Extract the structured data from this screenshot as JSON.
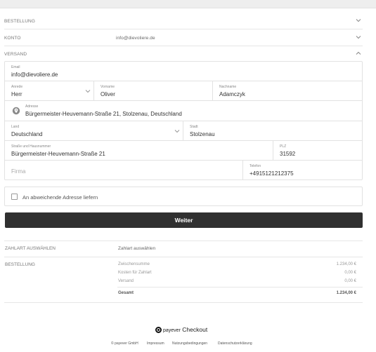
{
  "sections": {
    "bestellung_top": "BESTELLUNG",
    "konto": "KONTO",
    "konto_value": "info@dievoliere.de",
    "versand": "VERSAND"
  },
  "form": {
    "email_label": "Email",
    "email_value": "info@dievoliere.de",
    "anrede_label": "Anrede",
    "anrede_value": "Herr",
    "vorname_label": "Vorname",
    "vorname_value": "Oliver",
    "nachname_label": "Nachname",
    "nachname_value": "Adamczyk",
    "adresse_label": "Adresse",
    "adresse_value": "Bürgermeister-Heuvemann-Straße 21, Stolzenau, Deutschland",
    "land_label": "Land",
    "land_value": "Deutschland",
    "stadt_label": "Stadt",
    "stadt_value": "Stolzenau",
    "strasse_label": "Straße und Hausnummer",
    "strasse_value": "Bürgermeister-Heuvemann-Straße 21",
    "plz_label": "PLZ",
    "plz_value": "31592",
    "firma_placeholder": "Firma",
    "telefon_label": "Telefon",
    "telefon_value": "+4915121212375"
  },
  "checkbox_label": "An abweichende Adresse liefern",
  "weiter_button": "Weiter",
  "zahlart": {
    "label": "ZAHLART AUSWÄHLEN",
    "value": "Zahlart auswählen"
  },
  "summary": {
    "label": "BESTELLUNG",
    "rows": [
      {
        "name": "Zwischensumme",
        "amount": "1.234,00 €"
      },
      {
        "name": "Kosten für Zahlart",
        "amount": "0,00 €"
      },
      {
        "name": "Versand",
        "amount": "0,00 €"
      }
    ],
    "total_label": "Gesamt",
    "total_amount": "1.234,00 €"
  },
  "footer": {
    "brand": "payever",
    "product": "Checkout",
    "links": [
      "© payever GmbH",
      "Impressum",
      "Nutzungsbedingungen",
      "Datenschutzerklärung"
    ]
  }
}
